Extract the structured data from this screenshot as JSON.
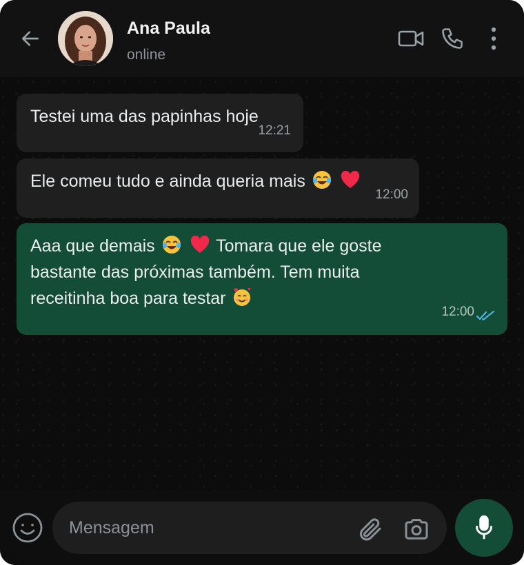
{
  "contact": {
    "name": "Ana Paula",
    "status": "online"
  },
  "messages": [
    {
      "direction": "incoming",
      "text": "Testei uma das papinhas hoje",
      "time": "12:21"
    },
    {
      "direction": "incoming",
      "text_before_emoji": "Ele comeu tudo e ainda queria mais",
      "emojis": [
        "face-with-tears-of-joy",
        "red-heart"
      ],
      "time": "12:00"
    },
    {
      "direction": "outgoing",
      "line1_a": "Aaa que demais",
      "line1_b": "Tomara que ele goste",
      "line2": "bastante das próximas também. Tem muita",
      "line3": "receitinha boa para testar",
      "emojis": [
        "face-with-tears-of-joy",
        "red-heart",
        "smiling-face-with-hearts"
      ],
      "time": "12:00",
      "read_receipt": "double-check-blue"
    }
  ],
  "composer": {
    "placeholder": "Mensagem"
  },
  "icons": {
    "back": "arrow-left-icon",
    "video": "video-camera-icon",
    "call": "phone-icon",
    "menu": "more-vertical-icon",
    "emoji": "emoji-smile-icon",
    "attach": "paperclip-icon",
    "camera": "camera-icon",
    "mic": "microphone-icon"
  },
  "colors": {
    "header_bg": "#121212",
    "incoming_bubble": "#1f1f1f",
    "outgoing_bubble": "#144d37",
    "accent_green": "#144d37",
    "read_tick": "#53bdeb"
  }
}
